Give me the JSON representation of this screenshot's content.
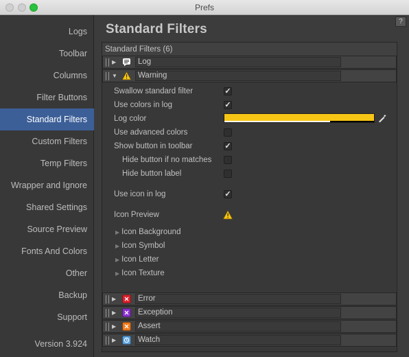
{
  "window": {
    "title": "Prefs"
  },
  "sidebar": {
    "items": [
      {
        "label": "Logs",
        "active": false
      },
      {
        "label": "Toolbar",
        "active": false
      },
      {
        "label": "Columns",
        "active": false
      },
      {
        "label": "Filter Buttons",
        "active": false
      },
      {
        "label": "Standard Filters",
        "active": true
      },
      {
        "label": "Custom Filters",
        "active": false
      },
      {
        "label": "Temp Filters",
        "active": false
      },
      {
        "label": "Wrapper and Ignore",
        "active": false
      },
      {
        "label": "Shared Settings",
        "active": false
      },
      {
        "label": "Source Preview",
        "active": false
      },
      {
        "label": "Fonts And Colors",
        "active": false
      },
      {
        "label": "Other",
        "active": false
      },
      {
        "label": "Backup",
        "active": false
      },
      {
        "label": "Support",
        "active": false
      }
    ],
    "version": "Version 3.924"
  },
  "main": {
    "title": "Standard Filters",
    "help_label": "?",
    "panel_header": "Standard Filters (6)",
    "filters": [
      {
        "name": "Log",
        "icon": "log-icon",
        "expanded": false
      },
      {
        "name": "Warning",
        "icon": "warning-icon",
        "expanded": true
      },
      {
        "name": "Error",
        "icon": "error-icon",
        "expanded": false
      },
      {
        "name": "Exception",
        "icon": "exception-icon",
        "expanded": false
      },
      {
        "name": "Assert",
        "icon": "assert-icon",
        "expanded": false
      },
      {
        "name": "Watch",
        "icon": "watch-icon",
        "expanded": false
      }
    ],
    "warning_settings": {
      "swallow": {
        "label": "Swallow standard filter",
        "checked": true
      },
      "use_colors": {
        "label": "Use colors in log",
        "checked": true
      },
      "log_color": {
        "label": "Log color",
        "color": "#f7c515"
      },
      "advanced_colors": {
        "label": "Use advanced colors",
        "checked": false
      },
      "show_button": {
        "label": "Show button in toolbar",
        "checked": true
      },
      "hide_if_no_matches": {
        "label": "Hide button if no matches",
        "checked": false
      },
      "hide_label": {
        "label": "Hide button label",
        "checked": false
      },
      "use_icon": {
        "label": "Use icon in log",
        "checked": true
      },
      "icon_preview": {
        "label": "Icon Preview"
      },
      "icon_background": "Icon Background",
      "icon_symbol": "Icon Symbol",
      "icon_letter": "Icon Letter",
      "icon_texture": "Icon Texture"
    }
  },
  "colors": {
    "accent": "#3d5f98",
    "warning": "#f7c515",
    "error": "#d9202a",
    "exception": "#8a2fcf",
    "assert": "#ee7a1c",
    "watch": "#5aa0dc"
  }
}
